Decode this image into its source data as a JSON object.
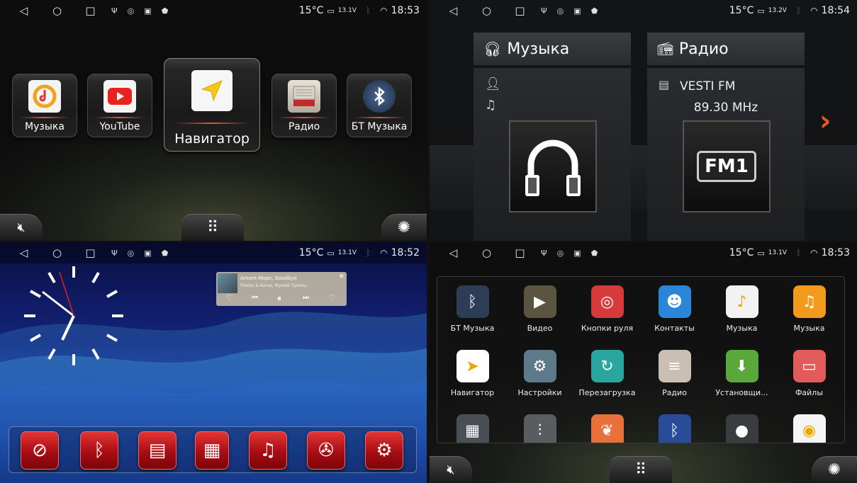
{
  "status_bars": [
    {
      "temp": "15°C",
      "volt": "13.1V",
      "time": "18:53"
    },
    {
      "temp": "15°C",
      "volt": "13.2V",
      "time": "18:54"
    },
    {
      "temp": "15°C",
      "volt": "13.1V",
      "time": "18:52"
    },
    {
      "temp": "15°C",
      "volt": "13.1V",
      "time": "18:53"
    }
  ],
  "home": {
    "tiles": [
      {
        "label": "Музыка",
        "icon": "music-player-icon"
      },
      {
        "label": "YouTube",
        "icon": "youtube-icon"
      },
      {
        "label": "Навигатор",
        "icon": "navigator-icon"
      },
      {
        "label": "Радио",
        "icon": "radio-icon"
      },
      {
        "label": "БТ Музыка",
        "icon": "bluetooth-music-icon"
      }
    ]
  },
  "widgets": {
    "music": {
      "title": "Музыка"
    },
    "radio": {
      "title": "Радио",
      "station": "VESTI FM",
      "frequency": "89.30 MHz",
      "band": "FM1"
    }
  },
  "desktop": {
    "player": {
      "song": "Amore Mope, Goodbye",
      "artist": "Filatov & Karas, Мумий Тролль"
    },
    "dock": [
      "navigation-icon",
      "bluetooth-icon",
      "radio-icon",
      "apps-icon",
      "music-icon",
      "video-icon",
      "settings-icon"
    ]
  },
  "drawer": {
    "apps": [
      {
        "label": "БТ Музыка",
        "color": "#2c3d55",
        "glyph": "ᛒ"
      },
      {
        "label": "Видео",
        "color": "#5b5440",
        "glyph": "▶"
      },
      {
        "label": "Кнопки руля",
        "color": "#d63a3a",
        "glyph": "◎"
      },
      {
        "label": "Контакты",
        "color": "#2a86d9",
        "glyph": "☻"
      },
      {
        "label": "Музыка",
        "color": "#f2f2f2",
        "glyph": "♪"
      },
      {
        "label": "Музыка",
        "color": "#f29a1a",
        "glyph": "♫"
      },
      {
        "label": "Навигатор",
        "color": "#ffffff",
        "glyph": "➤"
      },
      {
        "label": "Настройки",
        "color": "#5c7a8a",
        "glyph": "⚙"
      },
      {
        "label": "Перезагрузка",
        "color": "#2aa6a0",
        "glyph": "↻"
      },
      {
        "label": "Радио",
        "color": "#c9c0b3",
        "glyph": "≡"
      },
      {
        "label": "Установщи...",
        "color": "#5aa83a",
        "glyph": "⬇"
      },
      {
        "label": "Файлы",
        "color": "#e25b5b",
        "glyph": "▭"
      },
      {
        "label": "",
        "color": "#4a4f55",
        "glyph": "▦"
      },
      {
        "label": "",
        "color": "#5a5d60",
        "glyph": "⫶"
      },
      {
        "label": "",
        "color": "#e8703a",
        "glyph": "❦"
      },
      {
        "label": "",
        "color": "#2a4a9a",
        "glyph": "ᛒ"
      },
      {
        "label": "",
        "color": "#3a3d40",
        "glyph": "●"
      },
      {
        "label": "",
        "color": "#f5f5f5",
        "glyph": "◉"
      }
    ]
  }
}
